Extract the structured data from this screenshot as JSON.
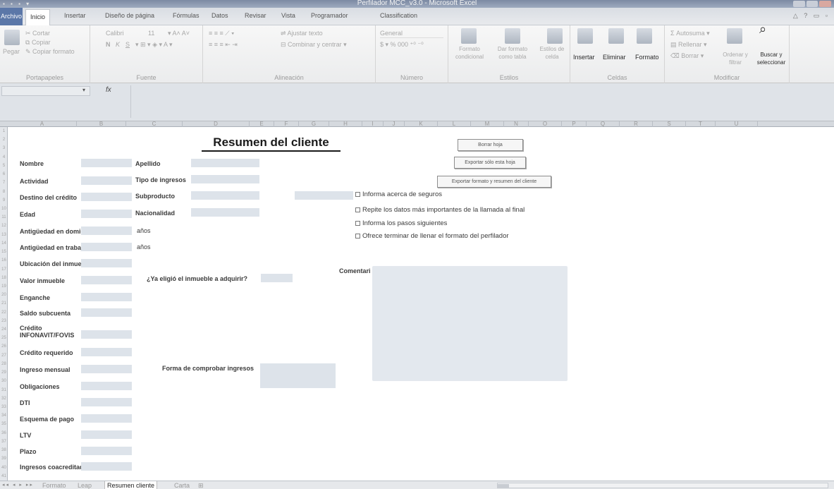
{
  "window": {
    "title": "Perfilador MCC_v3.0 - Microsoft Excel"
  },
  "ribbon_tabs": [
    {
      "label": "Archivo"
    },
    {
      "label": "Inicio"
    },
    {
      "label": "Insertar"
    },
    {
      "label": "Diseño de página"
    },
    {
      "label": "Fórmulas"
    },
    {
      "label": "Datos"
    },
    {
      "label": "Revisar"
    },
    {
      "label": "Vista"
    },
    {
      "label": "Programador"
    },
    {
      "label": "Classification"
    }
  ],
  "ribbon": {
    "clipboard": {
      "paste": "Pegar",
      "cut": "Cortar",
      "copy": "Copiar",
      "format_painter": "Copiar formato",
      "label": "Portapapeles"
    },
    "font": {
      "name": "Calibri",
      "size": "11",
      "bold": "N",
      "italic": "K",
      "underline": "S",
      "label": "Fuente"
    },
    "alignment": {
      "wrap": "Ajustar texto",
      "merge": "Combinar y centrar",
      "label": "Alineación"
    },
    "number": {
      "format": "General",
      "label": "Número"
    },
    "styles": {
      "conditional": "Formato condicional",
      "table": "Dar formato como tabla",
      "cell": "Estilos de celda",
      "label": "Estilos"
    },
    "cells": {
      "insert": "Insertar",
      "delete": "Eliminar",
      "format": "Formato",
      "label": "Celdas"
    },
    "editing": {
      "autosum": "Autosuma",
      "fill": "Rellenar",
      "clear": "Borrar",
      "sort": "Ordenar y filtrar",
      "find": "Buscar y seleccionar",
      "label": "Modificar"
    }
  },
  "formula_bar": {
    "fx": "fx"
  },
  "columns": [
    "A",
    "B",
    "C",
    "D",
    "E",
    "F",
    "G",
    "H",
    "I",
    "J",
    "K",
    "L",
    "M",
    "N",
    "O",
    "P",
    "Q",
    "R",
    "S",
    "T",
    "U"
  ],
  "rows": [
    "1",
    "2",
    "3",
    "4",
    "5",
    "6",
    "7",
    "8",
    "9",
    "10",
    "11",
    "12",
    "13",
    "14",
    "15",
    "16",
    "17",
    "18",
    "19",
    "20",
    "21",
    "22",
    "23",
    "24",
    "25",
    "26",
    "27",
    "28",
    "29",
    "30",
    "31",
    "32",
    "33",
    "34",
    "35",
    "36",
    "37",
    "38",
    "39",
    "40",
    "41"
  ],
  "sheet": {
    "title": "Resumen del cliente",
    "labels_left": [
      "Nombre",
      "Actividad",
      "Destino del crédito",
      "Edad",
      "Antigüedad en domicilio",
      "Antigüedad en trabajo",
      "Ubicación del inmueble",
      "Valor inmueble",
      "Enganche",
      "Saldo subcuenta",
      "Crédito",
      "INFONAVIT/FOVIS",
      "Crédito requerido",
      "Ingreso mensual",
      "Obligaciones",
      "DTI",
      "Esquema de pago",
      "LTV",
      "Plazo",
      "Ingresos coacreditado"
    ],
    "labels_mid": [
      "Apellido",
      "Tipo de ingresos",
      "Subproducto",
      "Nacionalidad"
    ],
    "years_unit": "años",
    "question_property": "¿Ya eligió el inmueble a adquirir?",
    "income_proof": "Forma de comprobar ingresos",
    "comments": "Comentari",
    "buttons": {
      "clear": "Borrar hoja",
      "export_sheet": "Exportar sólo esta hoja",
      "export_all": "Exportar formato y resumen del cliente"
    },
    "checks": [
      "Informa acerca de seguros",
      "Repite los datos más importantes de la llamada al final",
      "Informa los pasos siguientes",
      "Ofrece terminar de llenar el formato del perfilador"
    ]
  },
  "sheet_tabs": [
    "Formato",
    "Leap",
    "Resumen cliente",
    "Carta"
  ]
}
